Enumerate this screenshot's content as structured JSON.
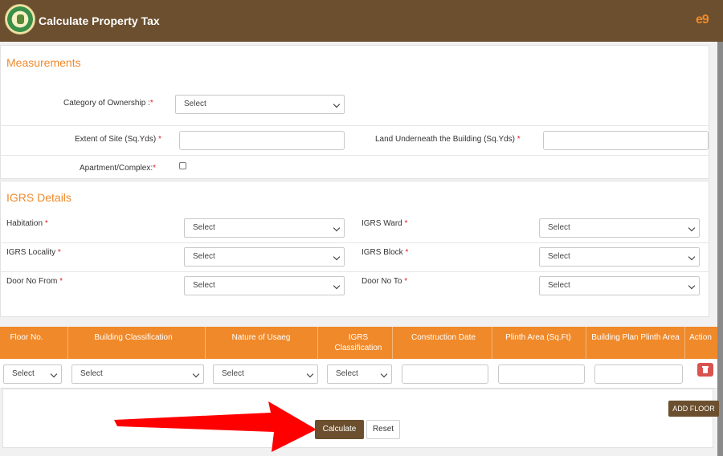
{
  "header": {
    "title": "Calculate Property Tax",
    "brand_mark": "e9"
  },
  "measurements": {
    "title": "Measurements",
    "ownership_label": "Category of Ownership :",
    "ownership_value": "Select",
    "extent_label": "Extent of Site (Sq.Yds)",
    "land_label": "Land Underneath the Building (Sq.Yds)",
    "apartment_label": "Apartment/Complex:",
    "required_mark": "*"
  },
  "igrs": {
    "title": "IGRS Details",
    "habitation_label": "Habitation",
    "ward_label": "IGRS Ward",
    "locality_label": "IGRS Locality",
    "block_label": "IGRS Block",
    "door_from_label": "Door No From",
    "door_to_label": "Door No To",
    "select_text": "Select",
    "required_mark": "*"
  },
  "floor_table": {
    "columns": [
      "Floor No.",
      "Building Classification",
      "Nature of Usaeg",
      "IGRS Classification",
      "Construction Date",
      "Plinth Area (Sq.Ft)",
      "Building Plan Plinth Area",
      "Action"
    ],
    "select_text": "Select"
  },
  "actions": {
    "add_floor": "ADD FLOOR",
    "calculate": "Calculate",
    "reset": "Reset"
  },
  "colors": {
    "header_bg": "#6b4f2e",
    "accent_orange": "#f0892a",
    "section_title": "#ef8a2b",
    "delete_red": "#d9534f",
    "pointer_arrow": "#ff0000"
  },
  "icons": {
    "logo": "state-emblem-icon",
    "delete": "trash-icon",
    "dropdown": "chevron-down-icon",
    "annotation": "red-arrow-pointer"
  }
}
